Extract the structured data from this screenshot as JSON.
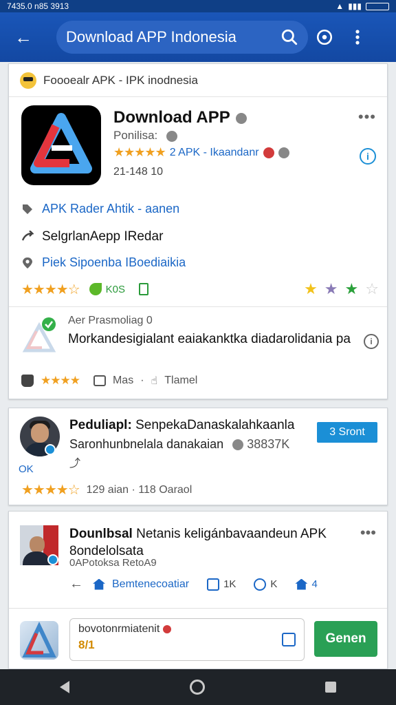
{
  "status": {
    "left": "7435.0 n85 3913",
    "battery": "80%"
  },
  "appbar": {
    "search_text": "Download APP Indonesia"
  },
  "crumb": {
    "text": "Foooealr APK - IPK inodnesia"
  },
  "app": {
    "title": "Download APP",
    "subtitle": "Ponilisa:",
    "rating_stars": "★★★★★",
    "rating_text": "2 APK - Ikaandanr",
    "numbers": "21-148   10",
    "rows": [
      {
        "text": "APK Rader Ahtik - aanen",
        "icon": "tag-icon"
      },
      {
        "text": "SelgrlanAepp IRedar",
        "icon": "share-icon"
      },
      {
        "text": "Piek Sipoenba IBoediaikia",
        "icon": "location-icon"
      }
    ],
    "row_stars": "★★★★☆",
    "kos": "K0S",
    "right_stars": [
      "★",
      "★",
      "★",
      "☆"
    ]
  },
  "review": {
    "name": "Aer Prasmoliag 0",
    "text": "Morkandesigialant eaiakanktka diadarolidania pa",
    "stars": "★★★★",
    "reply_label": "Mas",
    "like_label": "Tlamel"
  },
  "card2": {
    "title_bold": "Peduliapl:",
    "title_rest": "SenpekaDanaskalahkaanla",
    "subtitle": "Saronhunbnelala danakaian",
    "count": "38837K",
    "ok_label": "OK",
    "button": "3 Sront",
    "stars": "★★★★☆",
    "rating_text": "129 aian · 118 Oaraol"
  },
  "card3": {
    "title_bold": "Dounlbsal",
    "title_rest": "Netanis keligánbavaandeun APK 8ondelolsata",
    "sub": "0APotoksa RetoA9",
    "action_label": "Bemtenecoatiar",
    "like_count": "1K",
    "comment_count": "K",
    "share_count": "4"
  },
  "bottom": {
    "input_placeholder": "bovotonrmiatenit",
    "input_value": "8/1",
    "button": "Genen"
  }
}
